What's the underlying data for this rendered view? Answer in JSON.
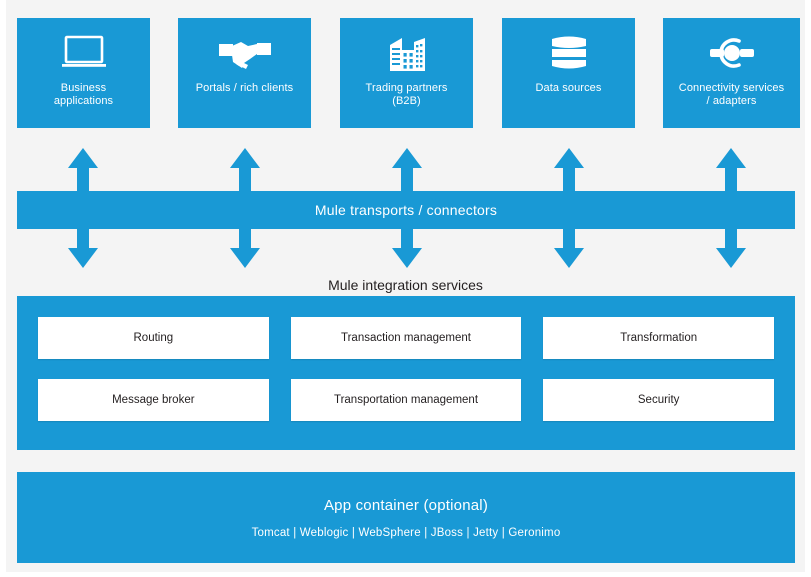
{
  "colors": {
    "brand_blue": "#1999d5",
    "page_bg": "#f4f4f4",
    "box_white": "#ffffff",
    "text_dark": "#231f20"
  },
  "top_row": {
    "items": [
      {
        "label": "Business\napplications",
        "icon": "laptop-icon"
      },
      {
        "label": "Portals / rich clients",
        "icon": "handshake-icon"
      },
      {
        "label": "Trading partners\n(B2B)",
        "icon": "buildings-icon"
      },
      {
        "label": "Data sources",
        "icon": "database-icon"
      },
      {
        "label": "Connectivity services\n/ adapters",
        "icon": "connector-ring-icon"
      }
    ]
  },
  "arrows": {
    "icon": "double-headed-vertical-arrow-icon",
    "count": 5
  },
  "transport_bar": {
    "label": "Mule transports / connectors"
  },
  "integration": {
    "title": "Mule integration services",
    "services": [
      "Routing",
      "Transaction management",
      "Transformation",
      "Message broker",
      "Transportation management",
      "Security"
    ]
  },
  "app_container": {
    "title": "App container (optional)",
    "subtitle": "Tomcat  |  Weblogic  |  WebSphere  |  JBoss  |  Jetty  |  Geronimo"
  }
}
